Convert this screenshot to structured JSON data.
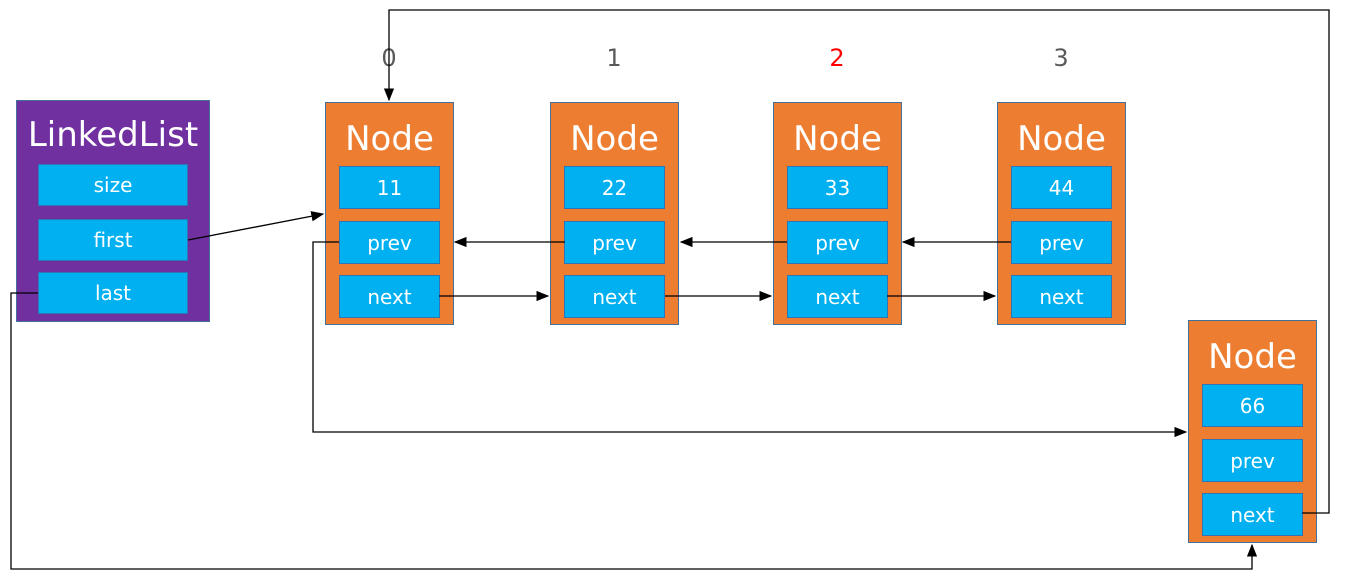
{
  "linked_list": {
    "title": "LinkedList",
    "fields": [
      "size",
      "first",
      "last"
    ]
  },
  "indices": [
    {
      "label": "0",
      "color": "#595959"
    },
    {
      "label": "1",
      "color": "#595959"
    },
    {
      "label": "2",
      "color": "#ff0000"
    },
    {
      "label": "3",
      "color": "#595959"
    }
  ],
  "nodes": [
    {
      "title": "Node",
      "value": "11",
      "prev": "prev",
      "next": "next"
    },
    {
      "title": "Node",
      "value": "22",
      "prev": "prev",
      "next": "next"
    },
    {
      "title": "Node",
      "value": "33",
      "prev": "prev",
      "next": "next"
    },
    {
      "title": "Node",
      "value": "44",
      "prev": "prev",
      "next": "next"
    },
    {
      "title": "Node",
      "value": "66",
      "prev": "prev",
      "next": "next"
    }
  ],
  "colors": {
    "linked_list": "#7030a0",
    "node": "#ed7d31",
    "field": "#00b0f0",
    "highlight_index": "#ff0000"
  }
}
